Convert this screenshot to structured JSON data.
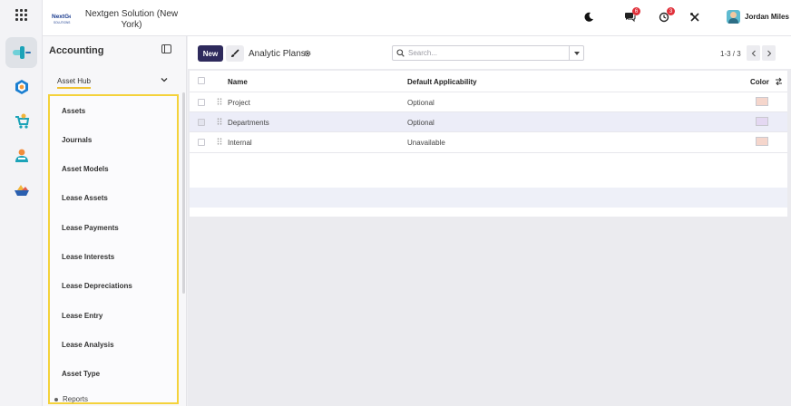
{
  "app": {
    "company": "Nextgen Solution (New York)",
    "logo_text": "NextGen SOLUTIONS",
    "user": "Jordan Miles",
    "messages_count": "6",
    "activities_count": "3"
  },
  "rail": {
    "items": [
      "apps-icon",
      "accounting-app-icon",
      "invoicing-app-icon",
      "sales-app-icon",
      "contacts-app-icon",
      "inventory-app-icon"
    ]
  },
  "sidebar": {
    "title": "Accounting",
    "section": "Asset Hub",
    "items": [
      "Assets",
      "Journals",
      "Asset Models",
      "Lease Assets",
      "Lease Payments",
      "Lease Interests",
      "Lease Depreciations",
      "Lease Entry",
      "Lease Analysis",
      "Asset Type"
    ],
    "reports": "Reports"
  },
  "toolbar": {
    "new_label": "New",
    "view_title": "Analytic Plans",
    "search_placeholder": "Search...",
    "pager": "1-3 / 3"
  },
  "table": {
    "columns": [
      "Name",
      "Default Applicability",
      "Color"
    ],
    "rows": [
      {
        "name": "Project",
        "applicability": "Optional",
        "color": "#f5d6cc"
      },
      {
        "name": "Departments",
        "applicability": "Optional",
        "color": "#e4d8f2"
      },
      {
        "name": "Internal",
        "applicability": "Unavailable",
        "color": "#f5d6cc"
      }
    ]
  },
  "colors": {
    "primary": "#2e2a5c",
    "highlight": "#f4d23b",
    "badge": "#e0313b"
  }
}
